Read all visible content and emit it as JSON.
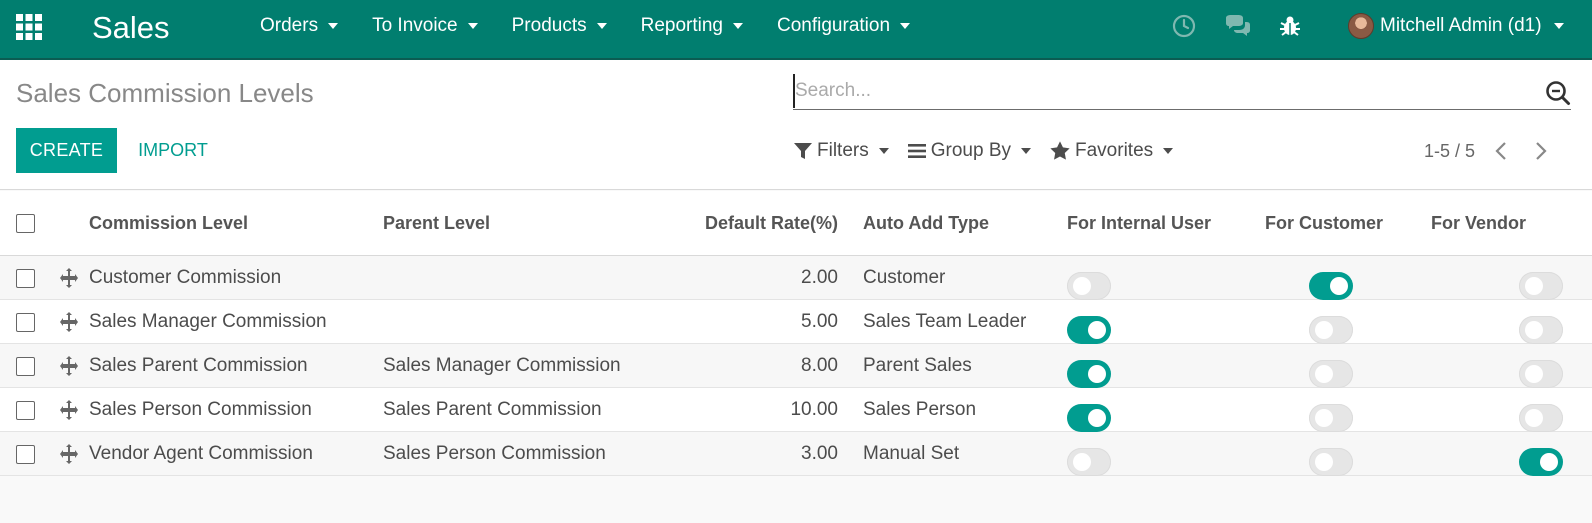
{
  "app": {
    "brand": "Sales",
    "menu": [
      {
        "label": "Orders"
      },
      {
        "label": "To Invoice"
      },
      {
        "label": "Products"
      },
      {
        "label": "Reporting"
      },
      {
        "label": "Configuration"
      }
    ],
    "user_label": "Mitchell Admin (d1)"
  },
  "control": {
    "title": "Sales Commission Levels",
    "search_placeholder": "Search...",
    "create_label": "CREATE",
    "import_label": "IMPORT",
    "filters_label": "Filters",
    "group_by_label": "Group By",
    "favorites_label": "Favorites",
    "pager": "1-5 / 5"
  },
  "table": {
    "headers": {
      "level": "Commission Level",
      "parent": "Parent Level",
      "rate": "Default Rate(%)",
      "auto": "Auto Add Type",
      "internal": "For Internal User",
      "customer": "For Customer",
      "vendor": "For Vendor"
    },
    "rows": [
      {
        "level": "Customer Commission",
        "parent": "",
        "rate": "2.00",
        "auto": "Customer",
        "internal": false,
        "customer": true,
        "vendor": false
      },
      {
        "level": "Sales Manager Commission",
        "parent": "",
        "rate": "5.00",
        "auto": "Sales Team Leader",
        "internal": true,
        "customer": false,
        "vendor": false
      },
      {
        "level": "Sales Parent Commission",
        "parent": "Sales Manager Commission",
        "rate": "8.00",
        "auto": "Parent Sales",
        "internal": true,
        "customer": false,
        "vendor": false
      },
      {
        "level": "Sales Person Commission",
        "parent": "Sales Parent Commission",
        "rate": "10.00",
        "auto": "Sales Person",
        "internal": true,
        "customer": false,
        "vendor": false
      },
      {
        "level": "Vendor Agent Commission",
        "parent": "Sales Person Commission",
        "rate": "3.00",
        "auto": "Manual Set",
        "internal": false,
        "customer": false,
        "vendor": true
      }
    ]
  },
  "colors": {
    "navbar": "#017e6f",
    "accent": "#019d90"
  }
}
